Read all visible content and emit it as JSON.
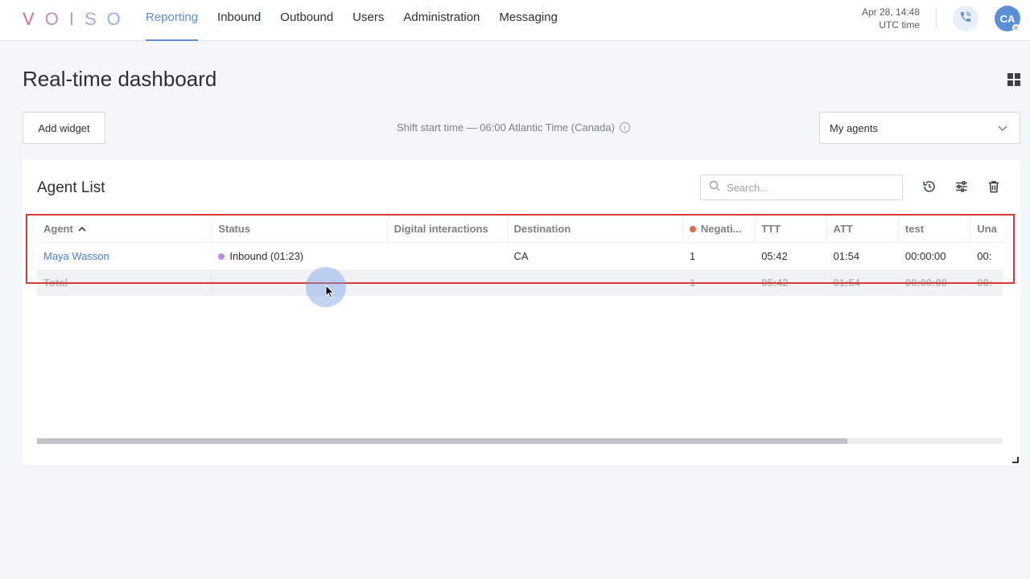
{
  "logo": {
    "letters": [
      "V",
      "O",
      "I",
      "S",
      "O"
    ],
    "colors": [
      "#d96b9a",
      "#c88ab8",
      "#b29dd1",
      "#9aaee0",
      "#8ab4ee"
    ]
  },
  "nav": {
    "items": [
      {
        "label": "Reporting",
        "active": true
      },
      {
        "label": "Inbound"
      },
      {
        "label": "Outbound"
      },
      {
        "label": "Users"
      },
      {
        "label": "Administration"
      },
      {
        "label": "Messaging"
      }
    ]
  },
  "header": {
    "date": "Apr 28, 14:48",
    "timezone": "UTC time",
    "phone_icon": "phone-icon",
    "avatar_initials": "CA"
  },
  "page": {
    "title": "Real-time dashboard",
    "add_widget_label": "Add widget",
    "shift_text": "Shift start time — 06:00 Atlantic Time (Canada)",
    "agents_select_value": "My agents"
  },
  "widget": {
    "title": "Agent List",
    "search_placeholder": "Search...",
    "columns": [
      "Agent",
      "Status",
      "Digital interactions",
      "Destination",
      "Negati...",
      "TTT",
      "ATT",
      "test",
      "Una"
    ],
    "rows": [
      {
        "agent": "Maya Wasson",
        "status": "Inbound (01:23)",
        "digital": "",
        "destination": "CA",
        "negative": "1",
        "ttt": "05:42",
        "att": "01:54",
        "test": "00:00:00",
        "una": "00:"
      }
    ],
    "total": {
      "label": "Total",
      "negative": "1",
      "ttt": "05:42",
      "att": "01:54",
      "test": "00:00:00",
      "una": "00:"
    }
  },
  "colors": {
    "accent": "#5b8fd8",
    "status_inbound": "#c08ae8",
    "negative_dot": "#e06a4a",
    "highlight": "#d83a32"
  }
}
